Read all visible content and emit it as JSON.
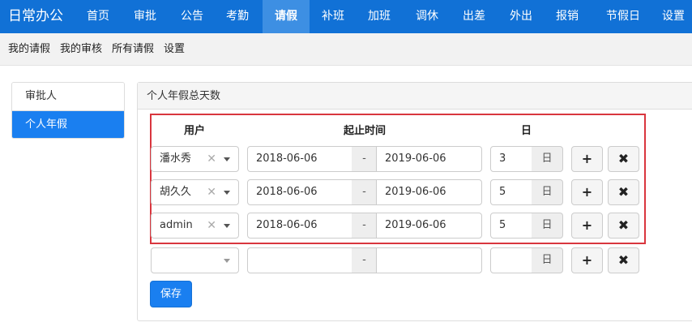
{
  "app": {
    "title": "日常办公"
  },
  "nav": {
    "items": [
      {
        "label": "首页"
      },
      {
        "label": "审批"
      },
      {
        "label": "公告"
      },
      {
        "label": "考勤"
      },
      {
        "label": "请假"
      },
      {
        "label": "补班"
      },
      {
        "label": "加班"
      },
      {
        "label": "调休"
      },
      {
        "label": "出差"
      },
      {
        "label": "外出"
      },
      {
        "label": "报销"
      },
      {
        "label": "节假日"
      },
      {
        "label": "设置"
      }
    ],
    "active": "请假"
  },
  "subnav": {
    "items": [
      {
        "label": "我的请假"
      },
      {
        "label": "我的审核"
      },
      {
        "label": "所有请假"
      },
      {
        "label": "设置"
      }
    ]
  },
  "sidemenu": {
    "items": [
      {
        "label": "审批人"
      },
      {
        "label": "个人年假"
      }
    ],
    "active": "个人年假"
  },
  "panel": {
    "title": "个人年假总天数",
    "headers": {
      "user": "用户",
      "period": "起止时间",
      "days": "日"
    },
    "rows": [
      {
        "user": "潘水秀",
        "start": "2018-06-06",
        "end": "2019-06-06",
        "days": "3",
        "unit": "日"
      },
      {
        "user": "胡久久",
        "start": "2018-06-06",
        "end": "2019-06-06",
        "days": "5",
        "unit": "日"
      },
      {
        "user": "admin",
        "start": "2018-06-06",
        "end": "2019-06-06",
        "days": "5",
        "unit": "日"
      }
    ],
    "new_row": {
      "user": "",
      "start": "",
      "end": "",
      "days": "",
      "unit": "日"
    },
    "sep": "-",
    "clear_glyph": "✕",
    "add_glyph": "+",
    "remove_glyph": "✖",
    "save_label": "保存"
  },
  "colors": {
    "topnav": "#1171d6",
    "active_nav": "#3d8fe3",
    "primary": "#1a7ff0",
    "highlight_border": "#d9363e"
  },
  "icons": {
    "add": "plus-icon",
    "remove": "close-icon",
    "clear": "clear-icon",
    "caret": "caret-down-icon"
  }
}
